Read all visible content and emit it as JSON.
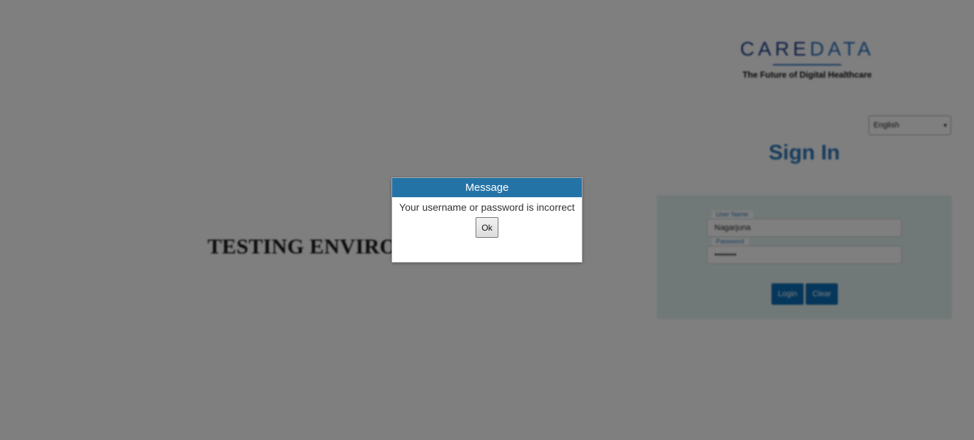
{
  "background": {
    "environment_title": "TESTING ENVIRO",
    "logo": {
      "word_part1": "CARE",
      "word_part2": "DATA",
      "tagline": "The Future of Digital Healthcare"
    },
    "language_select": {
      "selected": "English",
      "arrow": "▾"
    },
    "sign_in_heading": "Sign In",
    "login_form": {
      "username_label": "User Name",
      "username_value": "Nagarjuna",
      "password_label": "Password",
      "password_value": "••••••••",
      "login_button": "Login",
      "clear_button": "Clear"
    }
  },
  "dialog": {
    "title": "Message",
    "message": "Your username or password is incorrect",
    "ok_label": "Ok"
  },
  "colors": {
    "dialog_header": "#2473a6",
    "sign_in": "#2a77b8",
    "panel": "#e2f2f0",
    "button_blue": "#0b6fb8"
  }
}
